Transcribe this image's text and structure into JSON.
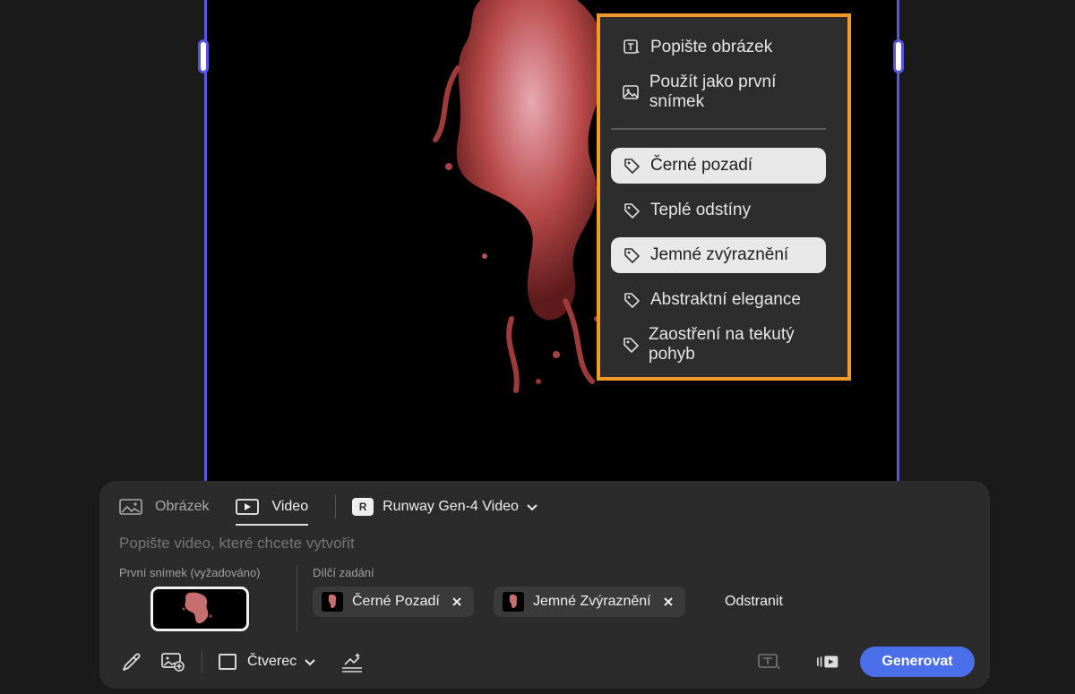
{
  "menu": {
    "actions": [
      {
        "label": "Popište obrázek",
        "icon": "describe-image-icon"
      },
      {
        "label": "Použít jako první snímek",
        "icon": "image-icon"
      }
    ],
    "tags": [
      {
        "label": "Černé pozadí",
        "selected": true
      },
      {
        "label": "Teplé odstíny",
        "selected": false
      },
      {
        "label": "Jemné zvýraznění",
        "selected": true
      },
      {
        "label": "Abstraktní elegance",
        "selected": false
      },
      {
        "label": "Zaostření na tekutý pohyb",
        "selected": false
      }
    ]
  },
  "panel": {
    "tabs": [
      {
        "label": "Obrázek",
        "icon": "image-icon",
        "active": false
      },
      {
        "label": "Video",
        "icon": "video-icon",
        "active": true
      }
    ],
    "model": {
      "label": "Runway Gen-4 Video",
      "logo": "R"
    },
    "prompt_placeholder": "Popište video, které chcete vytvořit",
    "first_frame_label": "První snímek (vyžadováno)",
    "sub_prompts_label": "Dílčí zadání",
    "chips": [
      {
        "label": "Černé Pozadí"
      },
      {
        "label": "Jemné Zvýraznění"
      }
    ],
    "remove_label": "Odstranit",
    "aspect_label": "Čtverec",
    "generate_label": "Generovat"
  },
  "colors": {
    "accent": "#4b6fe9",
    "highlight": "#f29a28",
    "frame_border": "#5a55e0"
  }
}
